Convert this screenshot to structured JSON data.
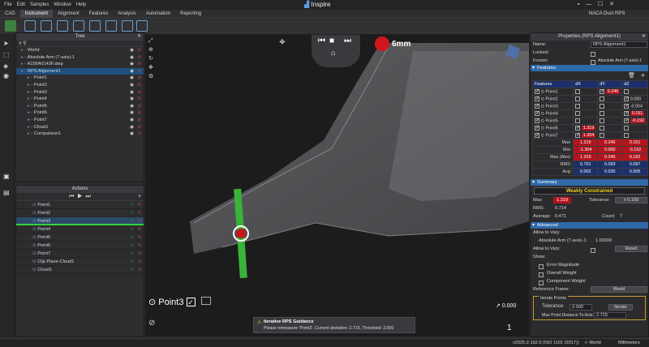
{
  "app": {
    "menu": [
      "File",
      "Edit",
      "Samples",
      "Window",
      "Help"
    ],
    "title": "Inspire",
    "project": "NACA Duct RPS Example.sai"
  },
  "ribbon": {
    "tabs": [
      "CAD",
      "Instrument",
      "Alignment",
      "Features",
      "Analysis",
      "Automation",
      "Reporting"
    ]
  },
  "tree": {
    "title": "Tree",
    "items": [
      {
        "label": "World",
        "indent": 0
      },
      {
        "label": "Absolute Arm (7-axis)-1",
        "indent": 0
      },
      {
        "label": "A156A0143F.step",
        "indent": 0
      },
      {
        "label": "RPS Alignment1",
        "indent": 0,
        "selected": true
      },
      {
        "label": "Point1",
        "indent": 1
      },
      {
        "label": "Point2",
        "indent": 1
      },
      {
        "label": "Point3",
        "indent": 1
      },
      {
        "label": "Point4",
        "indent": 1
      },
      {
        "label": "Point5",
        "indent": 1
      },
      {
        "label": "Point6",
        "indent": 1
      },
      {
        "label": "Point7",
        "indent": 1
      },
      {
        "label": "Cloud1",
        "indent": 1
      },
      {
        "label": "Comparison1",
        "indent": 1
      }
    ]
  },
  "actions": {
    "title": "Actions",
    "items": [
      {
        "label": "Point1"
      },
      {
        "label": "Point2"
      },
      {
        "label": "Point3",
        "selected": true
      },
      {
        "label": "Point4"
      },
      {
        "label": "Point5"
      },
      {
        "label": "Point6"
      },
      {
        "label": "Point7"
      },
      {
        "label": "Clip Plane-Cloud1"
      },
      {
        "label": "Cloud1"
      }
    ]
  },
  "viewport": {
    "distance": "6mm",
    "current_point": "Point3",
    "deviation_readout": "0.000",
    "page": "1",
    "guidance_title": "Iterative RPS Guidance",
    "guidance_text": "Please remeasure 'Point3'. Current deviation: 2.715, Threshold: 2.000"
  },
  "properties": {
    "title": "Properties (RPS Alignment1)",
    "name_label": "Name:",
    "name_value": "RPS Alignment1",
    "locked_label": "Locked:",
    "frozen_label": "Frozen:",
    "frozen_value": "Absolute Arm (7-axis)-1",
    "features_section": "Features",
    "table_headers": [
      "Features",
      "dX",
      "dY",
      "dZ"
    ],
    "rows": [
      {
        "name": "Point1",
        "dx": "",
        "dy": "0.246",
        "dz": "",
        "dy_red": true
      },
      {
        "name": "Point2",
        "dx": "",
        "dy": "",
        "dz": "0.080"
      },
      {
        "name": "Point3",
        "dx": "",
        "dy": "",
        "dz": "-0.004"
      },
      {
        "name": "Point4",
        "dx": "",
        "dy": "",
        "dz": "0.151",
        "dz_red": true
      },
      {
        "name": "Point5",
        "dx": "",
        "dy": "",
        "dz": "-0.192",
        "dz_red": true
      },
      {
        "name": "Point6",
        "dx": "1.319",
        "dy": "",
        "dz": "",
        "dx_red": true
      },
      {
        "name": "Point7",
        "dx": "1.304",
        "dy": "",
        "dz": "",
        "dx_red": true
      }
    ],
    "stats": [
      {
        "label": "Max:",
        "dx": "1.319",
        "dy": "0.246",
        "dz": "0.151",
        "red": true
      },
      {
        "label": "Min:",
        "dx": "-1.304",
        "dy": "0.000",
        "dz": "-0.192",
        "red": true
      },
      {
        "label": "Max (Abs):",
        "dx": "1.319",
        "dy": "0.246",
        "dz": "0.192",
        "red": true
      },
      {
        "label": "RMS:",
        "dx": "0.701",
        "dy": "0.093",
        "dz": "0.097"
      },
      {
        "label": "Avg:",
        "dx": "0.002",
        "dy": "0.035",
        "dz": "0.005"
      }
    ],
    "summary_section": "Summary",
    "constraint_status": "Weakly Constrained",
    "max_label": "Max:",
    "max_value": "1.319",
    "tolerance_label": "Tolerance:",
    "tolerance_value": "± 0.100",
    "rms_label": "RMS:",
    "rms_value": "0.714",
    "average_label": "Average:",
    "average_value": "0.471",
    "count_label": "Count:",
    "count_value": "7",
    "advanced_section": "Advanced",
    "allow_vary_label": "Allow to Vary:",
    "allow_vary_item": "Absolute Arm (7-axis)-1:",
    "allow_vary_value": "1.00000",
    "allow_vary_label2": "Allow to Vary:",
    "reset_label": "Reset",
    "show_label": "Show:",
    "show_options": [
      "Error Magnitude",
      "Overall Weight",
      "Component Weight"
    ],
    "ref_frame_label": "Reference Frame:",
    "ref_frame_value": "World",
    "iterate_title": "Iterate Points",
    "iter_tol_label": "Tolerance:",
    "iter_tol_value": "2.000",
    "iterate_button": "Iterate",
    "max_dist_label": "Max Point Distance To Axis:",
    "max_dist_value": "2.715"
  },
  "status": {
    "version": "v2025.2.162.0 (ISO 1101 (2017))",
    "frame": "World",
    "units": "Millimeters"
  },
  "colors": {
    "accent": "#2f6aa8",
    "red": "#b3151d",
    "green": "#3fbf3f"
  }
}
